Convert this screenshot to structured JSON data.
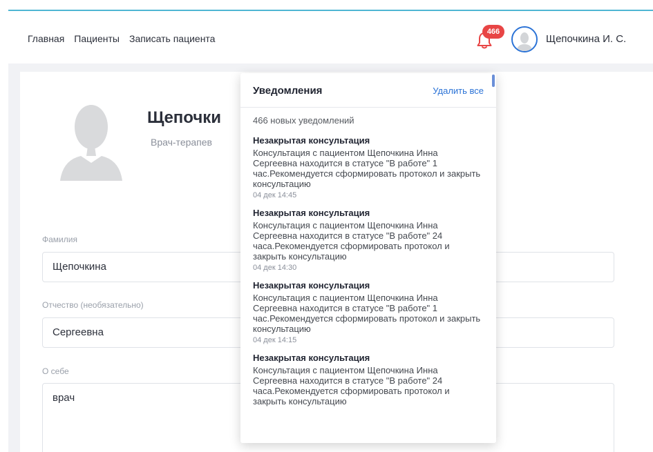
{
  "nav": {
    "home": "Главная",
    "patients": "Пациенты",
    "register": "Записать пациента"
  },
  "notifications_badge": "466",
  "user": {
    "name": "Щепочкина И. С."
  },
  "profile": {
    "name": "Щепочки",
    "role": "Врач-терапев"
  },
  "form": {
    "last_name_label": "Фамилия",
    "last_name_value": "Щепочкина",
    "patronymic_label": "Отчество (необязательно)",
    "patronymic_value": "Сергеевна",
    "about_label": "О себе",
    "about_value": "врач"
  },
  "dropdown": {
    "title": "Уведомления",
    "clear_all": "Удалить все",
    "count_text": "466 новых уведомлений",
    "items": [
      {
        "title": "Незакрытая консультация",
        "body": "Консультация с пациентом Щепочкина Инна Сергеевна находится в статусе \"В работе\" 1 час.Рекомендуется сформировать протокол и закрыть консультацию",
        "time": "04 дек 14:45"
      },
      {
        "title": "Незакрытая консультация",
        "body": "Консультация с пациентом Щепочкина Инна Сергеевна находится в статусе \"В работе\" 24 часа.Рекомендуется сформировать протокол и закрыть консультацию",
        "time": "04 дек 14:30"
      },
      {
        "title": "Незакрытая консультация",
        "body": "Консультация с пациентом Щепочкина Инна Сергеевна находится в статусе \"В работе\" 1 час.Рекомендуется сформировать протокол и закрыть консультацию",
        "time": "04 дек 14:15"
      },
      {
        "title": "Незакрытая консультация",
        "body": "Консультация с пациентом Щепочкина Инна Сергеевна находится в статусе \"В работе\" 24 часа.Рекомендуется сформировать протокол и закрыть консультацию",
        "time": ""
      }
    ]
  },
  "colors": {
    "accent": "#2a72d6",
    "badge": "#e84545",
    "top_border": "#4fb6d3"
  },
  "icons": {
    "bell": "bell-icon",
    "avatar": "user-avatar-icon"
  }
}
